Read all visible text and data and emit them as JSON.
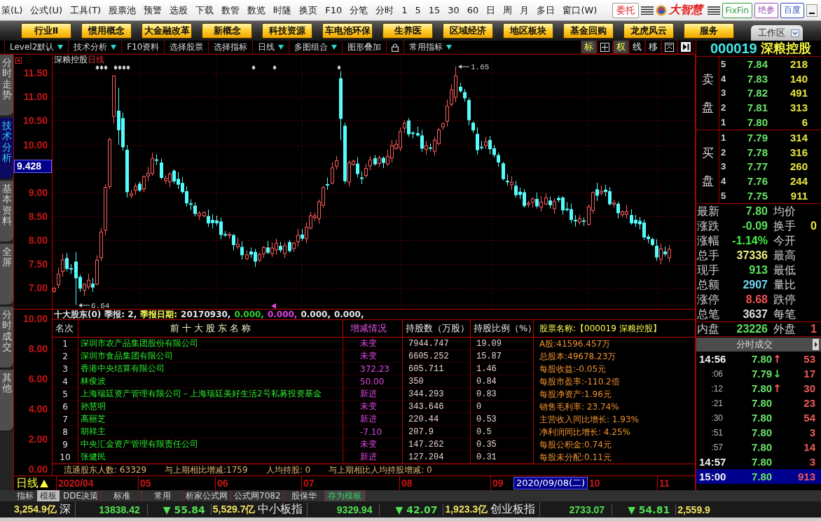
{
  "menu_bar": {
    "items": [
      "策(L)",
      "公式(U)",
      "工具(T)",
      "股票池",
      "预警",
      "选股",
      "下载",
      "数管",
      "数览",
      "时隧",
      "换页",
      "F10",
      "分笔",
      "分时",
      "1",
      "5",
      "15",
      "30",
      "60",
      "日",
      "周",
      "月",
      "多日",
      "窗口(W)"
    ],
    "trade_button": "委托",
    "brand": "大智慧",
    "links": [
      {
        "label": "FixFin",
        "color": "#2e9a3e"
      },
      {
        "label": "绝参",
        "color": "#9b4fb0"
      },
      {
        "label": "百度",
        "color": "#3050b8"
      }
    ]
  },
  "quick_bar": {
    "buttons": [
      "行业Ⅱ",
      "惯用概念",
      "大金融改革",
      "新概念",
      "科技资源",
      "车电池环保",
      "生养医",
      "区域经济",
      "地区板块",
      "基金回购",
      "龙虎风云",
      "服务"
    ],
    "workspace_tab": "工作区"
  },
  "tool_strip": {
    "items": [
      {
        "kind": "menu",
        "label": "Level2默认",
        "dropdown": true
      },
      {
        "kind": "menu",
        "label": "技术分析",
        "dropdown": true
      },
      {
        "kind": "menu",
        "label": "F10资料",
        "dropdown": false
      },
      {
        "kind": "menu",
        "label": "选择股票",
        "dropdown": false
      },
      {
        "kind": "menu",
        "label": "选择指标",
        "dropdown": false
      },
      {
        "kind": "menu",
        "label": "日线",
        "dropdown": true
      },
      {
        "kind": "menu",
        "label": "多图组合",
        "dropdown": true
      },
      {
        "kind": "menu",
        "label": "图形叠加",
        "dropdown": false
      },
      {
        "kind": "lock"
      },
      {
        "kind": "menu",
        "label": "常用指标",
        "dropdown": true
      }
    ],
    "tools": [
      {
        "kind": "text",
        "label": "标",
        "on": true
      },
      {
        "kind": "grid"
      },
      {
        "kind": "text",
        "label": "权",
        "on": true
      },
      {
        "kind": "text",
        "label": "线",
        "on": false
      },
      {
        "kind": "text",
        "label": "移",
        "on": false
      },
      {
        "kind": "collapse"
      },
      {
        "kind": "step"
      }
    ]
  },
  "side_tabs": [
    {
      "label": "分时走势",
      "selected": false
    },
    {
      "label": "技术分析",
      "selected": true
    },
    {
      "label": "基本资料",
      "selected": false
    },
    {
      "label": "全屏",
      "selected": false
    },
    {
      "label": "分时成交",
      "selected": false
    },
    {
      "label": "其他",
      "selected": false
    }
  ],
  "price_chart": {
    "title": "深粮控股",
    "period": "日线",
    "y_labels": [
      "11.50",
      "11.00",
      "10.50",
      "10.00",
      "9.00",
      "8.50",
      "8.00",
      "7.50",
      "7.00"
    ],
    "cursor_price": "9.428",
    "high_label": "1.65",
    "low_label": "6.64"
  },
  "volume_axis": {
    "y_labels": [
      "10.00",
      "8.00",
      "6.00",
      "4.00",
      "2.00",
      "0.00"
    ]
  },
  "shareholders": {
    "summary": [
      {
        "text": "十大股东(0)",
        "color": "#e4e4e4"
      },
      {
        "text": "季报: 2,",
        "color": "#e4e4e4"
      },
      {
        "text": "季报日期:",
        "color": "#ffff50"
      },
      {
        "text": "20170930,",
        "color": "#e4e4e4"
      },
      {
        "text": "0.000,",
        "color": "#30d030"
      },
      {
        "text": "0.000,",
        "color": "#e040e0"
      },
      {
        "text": "0.000,",
        "color": "#e4e4e4"
      },
      {
        "text": "0.000,",
        "color": "#e4e4e4"
      }
    ],
    "columns": [
      "名次",
      "前 十 大 股 东 名 称",
      "增减情况",
      "持股数（万股）",
      "持股比例（%）"
    ],
    "rows": [
      {
        "rank": "1",
        "name": "深圳市农产品集团股份有限公司",
        "change": "未变",
        "shares": "7944.747",
        "ratio": "19.09"
      },
      {
        "rank": "2",
        "name": "深圳市食品集团有限公司",
        "change": "未变",
        "shares": "6605.252",
        "ratio": "15.87"
      },
      {
        "rank": "3",
        "name": "香港中央结算有限公司",
        "change": "372.23",
        "shares": "605.711",
        "ratio": "1.46"
      },
      {
        "rank": "4",
        "name": "林俊波",
        "change": "50.00",
        "shares": "350",
        "ratio": "0.84"
      },
      {
        "rank": "5",
        "name": "上海瑞廷资产管理有限公司－上海瑞廷美好生活2号私募投资基金",
        "change": "新进",
        "shares": "344.293",
        "ratio": "0.83"
      },
      {
        "rank": "6",
        "name": "孙慧明",
        "change": "未变",
        "shares": "343.646",
        "ratio": "0"
      },
      {
        "rank": "7",
        "name": "高丽芝",
        "change": "新进",
        "shares": "220.44",
        "ratio": "0.53"
      },
      {
        "rank": "8",
        "name": "胡祥主",
        "change": "-7.10",
        "shares": "207.9",
        "ratio": "0.5"
      },
      {
        "rank": "9",
        "name": "中央汇金资产管理有限责任公司",
        "change": "未变",
        "shares": "147.262",
        "ratio": "0.35"
      },
      {
        "rank": "10",
        "name": "张健民",
        "change": "新进",
        "shares": "127.204",
        "ratio": "0.31"
      }
    ],
    "footer": [
      "流通股东人数: 63329",
      "与上期相比增减:1759",
      "人均持股: 0",
      "与上期相比人均持股增减: 0"
    ]
  },
  "stock_info": {
    "title": "股票名称:【000019 深粮控股】",
    "lines": [
      "A股:41596.457万",
      "总股本:49678.23万",
      "每股收益:-0.05元",
      "每股市盈率:-110.2倍",
      "每股净资产:1.96元",
      "销售毛利率: 23.74%",
      "主营收入同比增长: 1.93%",
      "净利润同比增长: 4.25%",
      "每股公积金:0.74元",
      "每股未分配:0.11元"
    ]
  },
  "date_axis": {
    "period": "日线",
    "months": [
      "2020/04",
      "05",
      "06",
      "07",
      "08",
      "09",
      "10",
      "11"
    ],
    "cursor_date": "2020/09/08(二)"
  },
  "bottom_tabs": [
    {
      "kind": "mode",
      "label": "指标",
      "selected": false
    },
    {
      "kind": "mode",
      "label": "模板",
      "selected": true
    },
    {
      "kind": "tab",
      "label": "DDE决策",
      "selected": false
    },
    {
      "kind": "tab",
      "label": "标准",
      "selected": false
    },
    {
      "kind": "tab",
      "label": "常用",
      "selected": false
    },
    {
      "kind": "tab",
      "label": "析家公式网",
      "selected": false
    },
    {
      "kind": "tab",
      "label": "公式网7082",
      "selected": false
    },
    {
      "kind": "tab",
      "label": "股保华",
      "selected": false
    },
    {
      "kind": "action",
      "label": "存为模板",
      "selected": false
    }
  ],
  "quote": {
    "code": "000019",
    "name": "深粮控股",
    "ask_label": [
      "卖",
      "盘"
    ],
    "asks": [
      {
        "rank": "5",
        "price": "7.84",
        "volume": "218"
      },
      {
        "rank": "4",
        "price": "7.83",
        "volume": "140"
      },
      {
        "rank": "3",
        "price": "7.82",
        "volume": "491"
      },
      {
        "rank": "2",
        "price": "7.81",
        "volume": "313"
      },
      {
        "rank": "1",
        "price": "7.80",
        "volume": "6"
      }
    ],
    "bid_label": [
      "买",
      "盘"
    ],
    "bids": [
      {
        "rank": "1",
        "price": "7.79",
        "volume": "314"
      },
      {
        "rank": "2",
        "price": "7.78",
        "volume": "316"
      },
      {
        "rank": "3",
        "price": "7.77",
        "volume": "260"
      },
      {
        "rank": "4",
        "price": "7.76",
        "volume": "244"
      },
      {
        "rank": "5",
        "price": "7.75",
        "volume": "911"
      }
    ],
    "stats": [
      {
        "kind": "plain",
        "label": "最新",
        "value": "7.80",
        "color": "#5ee05e",
        "right": {
          "label": "均价"
        }
      },
      {
        "kind": "plain",
        "label": "涨跌",
        "value": "-0.09",
        "color": "#5ee05e",
        "right": {
          "label": "换手",
          "value": "0",
          "color": "#e8e840"
        }
      },
      {
        "kind": "plain",
        "label": "涨幅",
        "value": "-1.14%",
        "color": "#40f040",
        "right": {
          "label": "今开"
        }
      },
      {
        "kind": "plain",
        "label": "总手",
        "value": "37336",
        "color": "#f0f080",
        "right": {
          "label": "最高"
        }
      },
      {
        "kind": "plain",
        "label": "现手",
        "value": "913",
        "color": "#5ee05e",
        "right": {
          "label": "最低"
        }
      },
      {
        "kind": "plain",
        "label": "总额",
        "value": "2907",
        "color": "#70d8f8",
        "right": {
          "label": "量比"
        }
      },
      {
        "kind": "plain",
        "label": "涨停",
        "value": "8.68",
        "color": "#f05050",
        "right": {
          "label": "跌停"
        }
      },
      {
        "kind": "plain",
        "label": "总笔",
        "value": "3637",
        "color": "#e0e0e0",
        "right": {
          "label": "每笔"
        }
      },
      {
        "kind": "boxed",
        "label": "内盘",
        "value": "23226",
        "color": "#5ee05e",
        "right": {
          "label": "外盘",
          "value": "1",
          "color": "#f05050"
        }
      }
    ],
    "ticks_title": "分时成交",
    "ticks": [
      {
        "kind": "full",
        "time": "14:56",
        "price": "7.80",
        "arrow": {
          "text": "↑",
          "color": "#ff5a5a"
        },
        "volume": "53",
        "selected": false
      },
      {
        "kind": "short",
        "time": ":06",
        "price": "7.79",
        "arrow": {
          "text": "↓",
          "color": "#40e040"
        },
        "volume": "17",
        "selected": false
      },
      {
        "kind": "short",
        "time": ":12",
        "price": "7.80",
        "arrow": {
          "text": "↑",
          "color": "#ff5a5a"
        },
        "volume": "30",
        "selected": false
      },
      {
        "kind": "short",
        "time": ":21",
        "price": "7.80",
        "volume": "23",
        "selected": false
      },
      {
        "kind": "short",
        "time": ":30",
        "price": "7.80",
        "volume": "54",
        "selected": false
      },
      {
        "kind": "short",
        "time": ":51",
        "price": "7.80",
        "volume": "3",
        "selected": false
      },
      {
        "kind": "short",
        "time": ":57",
        "price": "7.80",
        "volume": "14",
        "selected": false
      },
      {
        "kind": "full",
        "time": "14:57",
        "price": "7.80",
        "volume": "3",
        "selected": false
      },
      {
        "kind": "full",
        "time": "15:00",
        "price": "7.80",
        "volume": "913",
        "selected": true
      }
    ]
  },
  "status_bar": [
    {
      "kind": "amount",
      "text": "3,254.9亿"
    },
    {
      "kind": "name",
      "text": "深"
    },
    {
      "kind": "index",
      "text": "13838.42"
    },
    {
      "kind": "change",
      "text": "▼ 55.84"
    },
    {
      "kind": "amount",
      "text": "5,529.7亿"
    },
    {
      "kind": "name",
      "text": "中小板指"
    },
    {
      "kind": "index",
      "text": "9329.94"
    },
    {
      "kind": "change",
      "text": "▼ 42.07"
    },
    {
      "kind": "amount",
      "text": "1,923.3亿"
    },
    {
      "kind": "name",
      "text": "创业板指"
    },
    {
      "kind": "index",
      "text": "2733.07"
    },
    {
      "kind": "change",
      "text": "▼ 54.81"
    },
    {
      "kind": "amount",
      "text": "2,559.9"
    }
  ]
}
